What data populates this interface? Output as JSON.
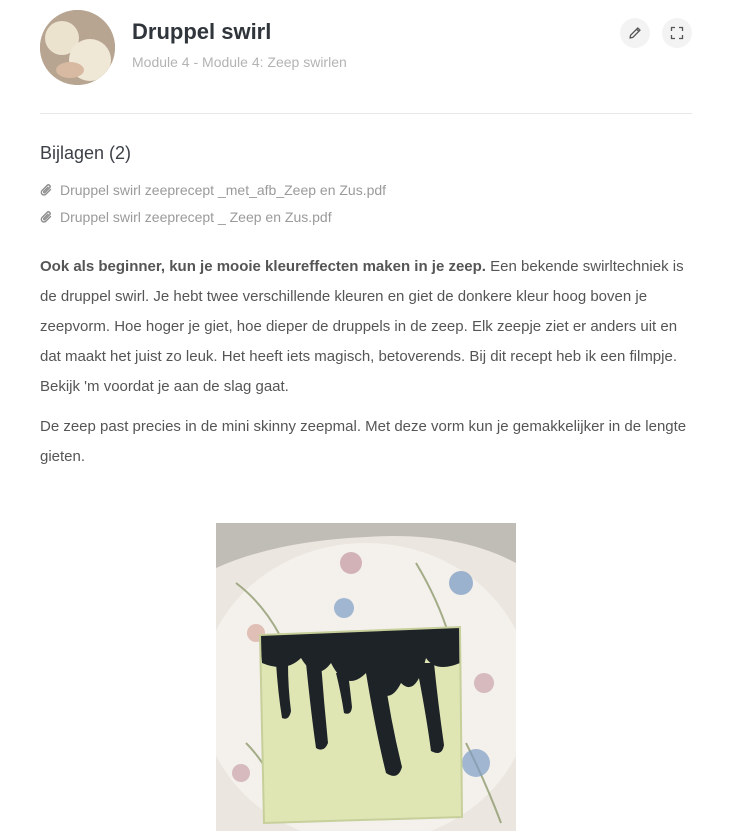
{
  "header": {
    "title": "Druppel swirl",
    "subtitle": "Module 4 - Module 4: Zeep swirlen",
    "edit_icon": "pencil-icon",
    "fullscreen_icon": "expand-icon"
  },
  "attachments": {
    "heading": "Bijlagen (2)",
    "icon": "paperclip-icon",
    "items": [
      {
        "label": "Druppel swirl zeeprecept _met_afb_Zeep en Zus.pdf"
      },
      {
        "label": "Druppel swirl zeeprecept _ Zeep en Zus.pdf"
      }
    ]
  },
  "content": {
    "intro_bold": "Ook als beginner, kun je mooie kleureffecten maken in je zeep.",
    "intro_rest": " Een bekende swirltechniek is de druppel swirl. Je hebt twee verschillende kleuren en giet de donkere kleur hoog boven je zeepvorm. Hoe hoger je giet, hoe dieper de druppels in de zeep. Elk zeepje ziet er anders uit en dat maakt het juist zo leuk. Het heeft iets magisch, betoverends. Bij dit recept heb ik een filmpje. Bekijk 'm voordat je aan de slag gaat.",
    "paragraph2": "De zeep past precies in de mini skinny zeepmal. Met deze vorm kun je gemakkelijker in de lengte gieten."
  },
  "colors": {
    "title": "#2f353b",
    "muted": "#b3b3b3",
    "soap_body": "#dfe6b4",
    "soap_swirl": "#1e2328"
  }
}
